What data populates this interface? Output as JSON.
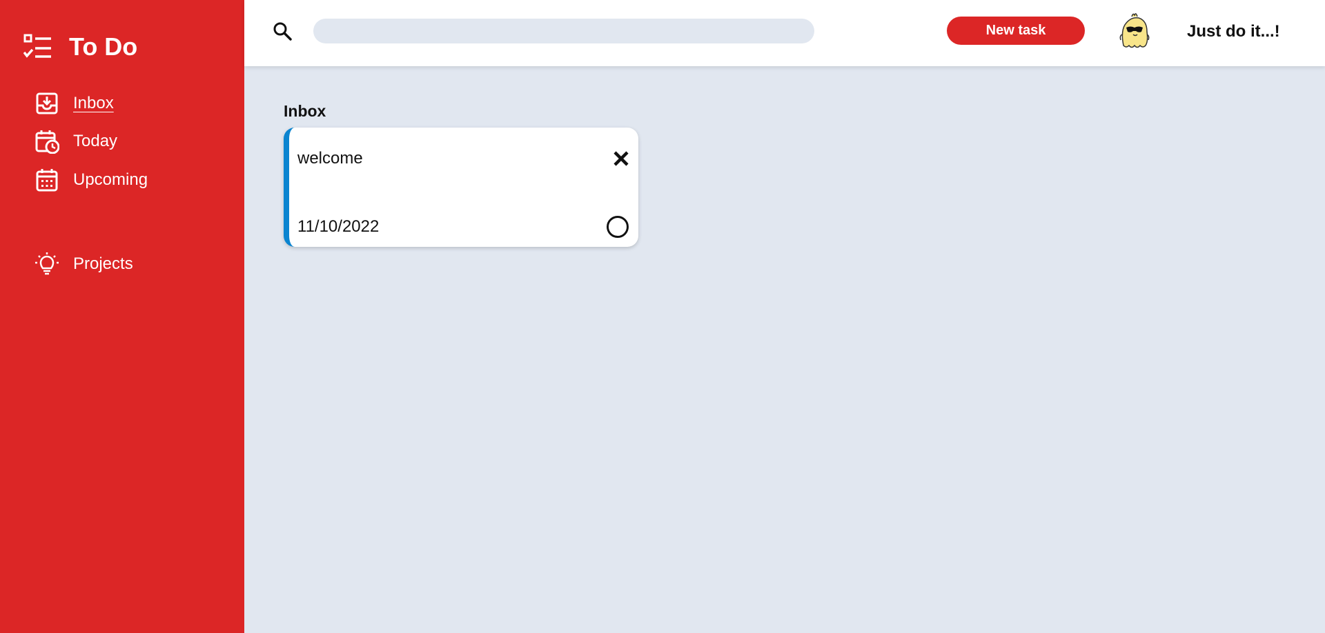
{
  "app": {
    "title": "To Do",
    "brand_icon": "checklist-icon",
    "accent_color": "#dc2626",
    "background_color": "#e1e7f0"
  },
  "sidebar": {
    "items": [
      {
        "label": "Inbox",
        "icon": "inbox-icon",
        "active": true
      },
      {
        "label": "Today",
        "icon": "calendar-clock-icon",
        "active": false
      },
      {
        "label": "Upcoming",
        "icon": "calendar-icon",
        "active": false
      },
      {
        "label": "Projects",
        "icon": "lightbulb-icon",
        "active": false
      }
    ]
  },
  "header": {
    "search_icon": "search-icon",
    "search_value": "",
    "new_task_label": "New task",
    "avatar_icon": "chick-sunglasses-avatar",
    "motto": "Just do it...!"
  },
  "main": {
    "section_title": "Inbox",
    "tasks": [
      {
        "title": "welcome",
        "date": "11/10/2022",
        "priority_color": "#0a84d0",
        "completed": false
      }
    ]
  }
}
